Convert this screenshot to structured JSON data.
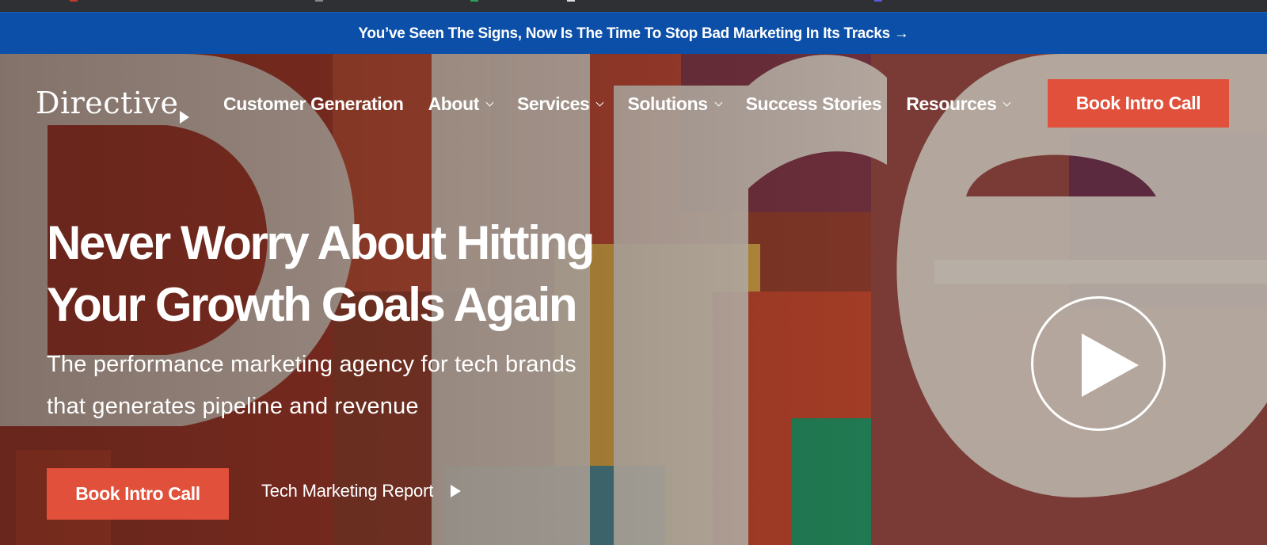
{
  "announcement": {
    "text": "You’ve Seen The Signs, Now Is The Time To Stop Bad Marketing In Its Tracks →"
  },
  "header": {
    "logo_text": "Directive",
    "nav": [
      {
        "label": "Customer Generation",
        "has_dropdown": false
      },
      {
        "label": "About",
        "has_dropdown": true
      },
      {
        "label": "Services",
        "has_dropdown": true
      },
      {
        "label": "Solutions",
        "has_dropdown": true
      },
      {
        "label": "Success Stories",
        "has_dropdown": false
      },
      {
        "label": "Resources",
        "has_dropdown": true
      }
    ],
    "cta_label": "Book Intro Call"
  },
  "hero": {
    "headline": "Never Worry About Hitting Your Growth Goals Again",
    "subheadline": "The performance marketing agency for tech brands that generates pipeline and revenue",
    "primary_cta": "Book Intro Call",
    "secondary_link": "Tech Marketing Report"
  },
  "colors": {
    "announcement_bg": "#0b4fa8",
    "cta_bg": "#e0503a",
    "hero_base": "#7a3a2c"
  },
  "icons": {
    "logo_mark": "arrow-right-icon",
    "dropdown": "chevron-down-icon",
    "report_link": "play-triangle-icon",
    "video": "play-icon"
  }
}
